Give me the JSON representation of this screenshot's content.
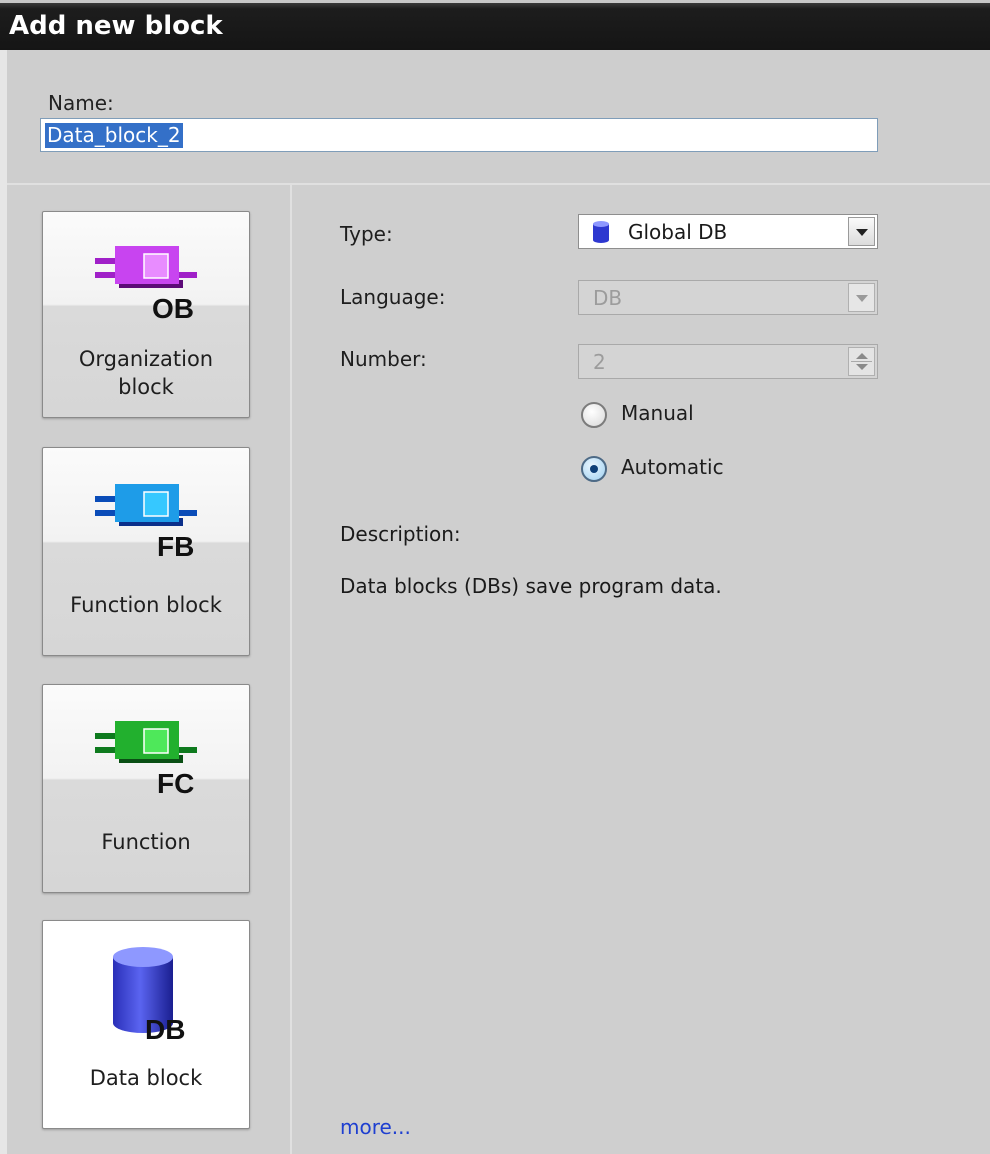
{
  "window": {
    "title": "Add new block"
  },
  "name_field": {
    "label": "Name:",
    "value": "Data_block_2"
  },
  "block_types": [
    {
      "label_line1": "Organization",
      "label_line2": "block",
      "badge": "OB",
      "color": "#c040e0",
      "selected": false
    },
    {
      "label_line1": "Function block",
      "label_line2": "",
      "badge": "FB",
      "color": "#1e9ce8",
      "selected": false
    },
    {
      "label_line1": "Function",
      "label_line2": "",
      "badge": "FC",
      "color": "#22b02e",
      "selected": false
    },
    {
      "label_line1": "Data block",
      "label_line2": "",
      "badge": "DB",
      "color": "#3a48e0",
      "selected": true
    }
  ],
  "form": {
    "type": {
      "label": "Type:",
      "value": "Global DB",
      "icon": "database-icon"
    },
    "language": {
      "label": "Language:",
      "value": "DB",
      "disabled": true
    },
    "number": {
      "label": "Number:",
      "value": "2",
      "disabled": true
    },
    "numbering": {
      "options": [
        {
          "label": "Manual",
          "checked": false
        },
        {
          "label": "Automatic",
          "checked": true
        }
      ]
    }
  },
  "description": {
    "label": "Description:",
    "text": "Data blocks (DBs) save program data.",
    "more_link": "more..."
  }
}
